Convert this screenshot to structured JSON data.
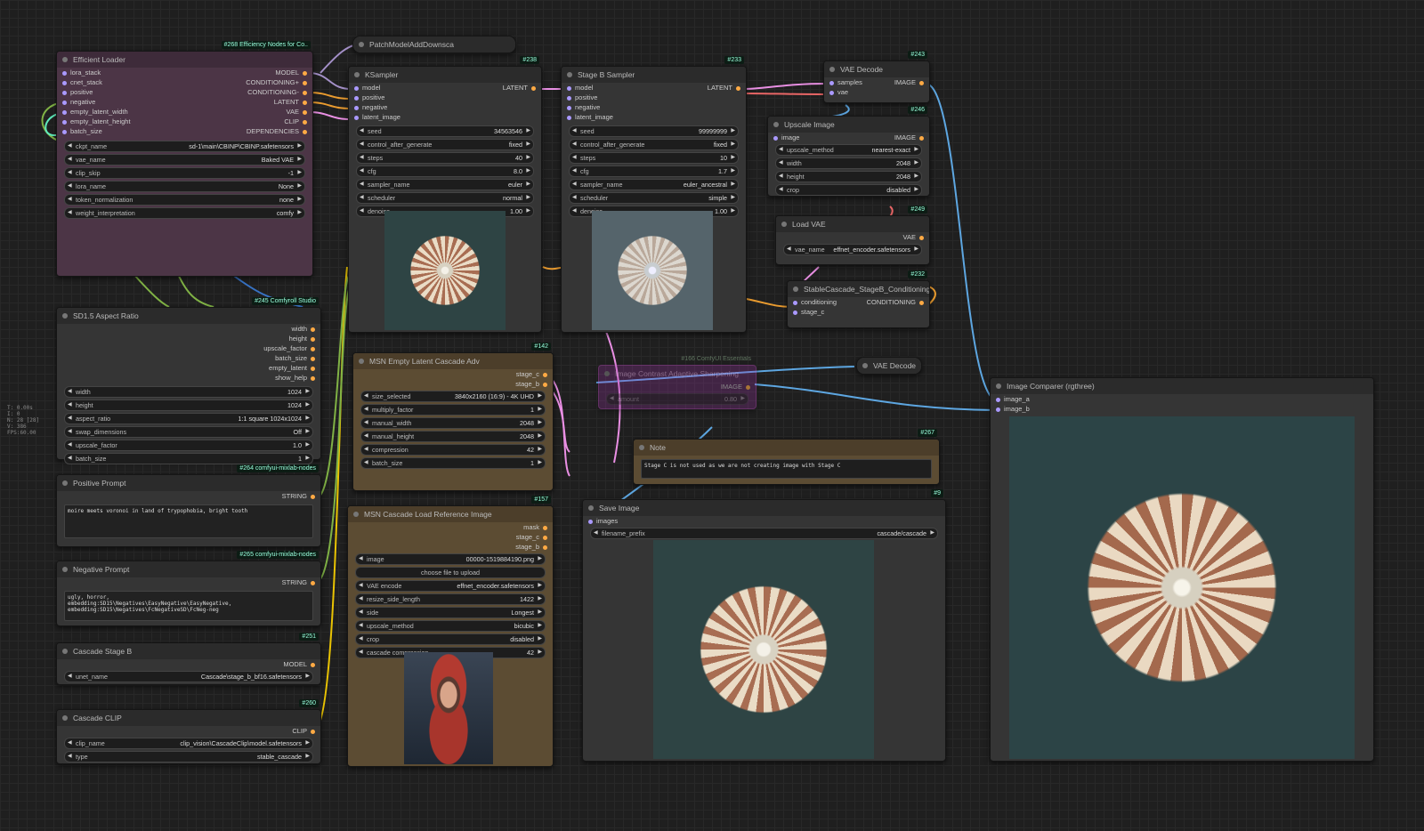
{
  "stats": [
    "T: 0.00s",
    "I: 0",
    "N: 28 [28]",
    "V: 386",
    "FPS:60.00"
  ],
  "nodes": {
    "efficient_loader": {
      "title": "Efficient Loader",
      "badge": "#268 Efficiency Nodes for Co..",
      "inputs": [
        "lora_stack",
        "cnet_stack",
        "positive",
        "negative",
        "empty_latent_width",
        "empty_latent_height",
        "batch_size"
      ],
      "outputs": [
        "MODEL",
        "CONDITIONING+",
        "CONDITIONING-",
        "LATENT",
        "VAE",
        "CLIP",
        "DEPENDENCIES"
      ],
      "widgets": [
        {
          "label": "ckpt_name",
          "value": "sd-1\\main\\CBINP\\CBINP.safetensors"
        },
        {
          "label": "vae_name",
          "value": "Baked VAE"
        },
        {
          "label": "clip_skip",
          "value": "-1"
        },
        {
          "label": "lora_name",
          "value": "None"
        },
        {
          "label": "token_normalization",
          "value": "none"
        },
        {
          "label": "weight_interpretation",
          "value": "comfy"
        }
      ]
    },
    "patch_model": {
      "title": "PatchModelAddDownsca"
    },
    "ksampler": {
      "title": "KSampler",
      "badge": "#238",
      "inputs": [
        "model",
        "positive",
        "negative",
        "latent_image"
      ],
      "outputs": [
        "LATENT"
      ],
      "widgets": [
        {
          "label": "seed",
          "value": "34563546"
        },
        {
          "label": "control_after_generate",
          "value": "fixed"
        },
        {
          "label": "steps",
          "value": "40"
        },
        {
          "label": "cfg",
          "value": "8.0"
        },
        {
          "label": "sampler_name",
          "value": "euler"
        },
        {
          "label": "scheduler",
          "value": "normal"
        },
        {
          "label": "denoise",
          "value": "1.00"
        }
      ]
    },
    "stageb_sampler": {
      "title": "Stage B Sampler",
      "badge": "#233",
      "inputs": [
        "model",
        "positive",
        "negative",
        "latent_image"
      ],
      "outputs": [
        "LATENT"
      ],
      "widgets": [
        {
          "label": "seed",
          "value": "99999999"
        },
        {
          "label": "control_after_generate",
          "value": "fixed"
        },
        {
          "label": "steps",
          "value": "10"
        },
        {
          "label": "cfg",
          "value": "1.7"
        },
        {
          "label": "sampler_name",
          "value": "euler_ancestral"
        },
        {
          "label": "scheduler",
          "value": "simple"
        },
        {
          "label": "denoise",
          "value": "1.00"
        }
      ]
    },
    "vae_decode": {
      "title": "VAE Decode",
      "badge": "#243",
      "inputs": [
        "samples",
        "vae"
      ],
      "outputs": [
        "IMAGE"
      ]
    },
    "upscale_image": {
      "title": "Upscale Image",
      "badge": "#246",
      "inputs": [
        "image"
      ],
      "outputs": [
        "IMAGE"
      ],
      "widgets": [
        {
          "label": "upscale_method",
          "value": "nearest-exact"
        },
        {
          "label": "width",
          "value": "2048"
        },
        {
          "label": "height",
          "value": "2048"
        },
        {
          "label": "crop",
          "value": "disabled"
        }
      ]
    },
    "load_vae": {
      "title": "Load VAE",
      "badge": "#249",
      "outputs": [
        "VAE"
      ],
      "widgets": [
        {
          "label": "vae_name",
          "value": "effnet_encoder.safetensors"
        }
      ]
    },
    "stablecascade_cond": {
      "title": "StableCascade_StageB_Conditioning",
      "badge": "#232",
      "inputs": [
        "conditioning",
        "stage_c"
      ],
      "outputs": [
        "CONDITIONING"
      ]
    },
    "vae_decode2": {
      "title": "VAE Decode"
    },
    "bypassed": {
      "title": "Image Contrast Adaptive Sharpening",
      "badge": "#166 ComfyUI Essentials",
      "outputs": [
        "IMAGE"
      ],
      "widgets": [
        {
          "label": "amount",
          "value": "0.80"
        }
      ]
    },
    "aspect_ratio": {
      "title": "SD1.5 Aspect Ratio",
      "badge": "#245 Comfyroll Studio",
      "outputs": [
        "width",
        "height",
        "upscale_factor",
        "batch_size",
        "empty_latent",
        "show_help"
      ],
      "widgets": [
        {
          "label": "width",
          "value": "1024"
        },
        {
          "label": "height",
          "value": "1024"
        },
        {
          "label": "aspect_ratio",
          "value": "1:1 square 1024x1024"
        },
        {
          "label": "swap_dimensions",
          "value": "Off"
        },
        {
          "label": "upscale_factor",
          "value": "1.0"
        },
        {
          "label": "batch_size",
          "value": "1"
        }
      ]
    },
    "positive_prompt": {
      "title": "Positive Prompt",
      "badge": "#264 comfyui-mixlab-nodes",
      "outputs": [
        "STRING"
      ],
      "text": "moire meets voronoi in land of trypophobia, bright tooth"
    },
    "negative_prompt": {
      "title": "Negative Prompt",
      "badge": "#265 comfyui-mixlab-nodes",
      "outputs": [
        "STRING"
      ],
      "text": "ugly, horror,\nembedding:SD15\\Negatives\\EasyNegative\\EasyNegative,\nembedding:SD15\\Negatives\\FcNegativeSD\\FcNeg-neg"
    },
    "cascade_stage_b": {
      "title": "Cascade Stage B",
      "badge": "#251",
      "outputs": [
        "MODEL"
      ],
      "widgets": [
        {
          "label": "unet_name",
          "value": "Cascade\\stage_b_bf16.safetensors"
        }
      ]
    },
    "cascade_clip": {
      "title": "Cascade CLIP",
      "badge": "#260",
      "outputs": [
        "CLIP"
      ],
      "widgets": [
        {
          "label": "clip_name",
          "value": "clip_vision\\CascadeClip\\model.safetensors"
        },
        {
          "label": "type",
          "value": "stable_cascade"
        }
      ]
    },
    "msn_empty": {
      "title": "MSN Empty Latent Cascade Adv",
      "badge": "#142",
      "outputs": [
        "stage_c",
        "stage_b"
      ],
      "widgets": [
        {
          "label": "size_selected",
          "value": "3840x2160 (16:9) - 4K UHD"
        },
        {
          "label": "multiply_factor",
          "value": "1"
        },
        {
          "label": "manual_width",
          "value": "2048"
        },
        {
          "label": "manual_height",
          "value": "2048"
        },
        {
          "label": "compression",
          "value": "42"
        },
        {
          "label": "batch_size",
          "value": "1"
        }
      ]
    },
    "msn_load_ref": {
      "title": "MSN Cascade Load Reference Image",
      "badge": "#157",
      "outputs": [
        "mask",
        "stage_c",
        "stage_b"
      ],
      "widgets": [
        {
          "label": "image",
          "value": "00000-1519884190.png"
        },
        {
          "button": "choose file to upload"
        },
        {
          "label": "VAE encode",
          "value": "effnet_encoder.safetensors"
        },
        {
          "label": "resize_side_length",
          "value": "1422"
        },
        {
          "label": "side",
          "value": "Longest"
        },
        {
          "label": "upscale_method",
          "value": "bicubic"
        },
        {
          "label": "crop",
          "value": "disabled"
        },
        {
          "label": "cascade compression",
          "value": "42"
        }
      ]
    },
    "note": {
      "title": "Note",
      "badge": "#267",
      "text": "Stage C is not used as we are not creating image with Stage C"
    },
    "save_image": {
      "title": "Save Image",
      "badge": "#9",
      "inputs": [
        "images"
      ],
      "widgets": [
        {
          "label": "filename_prefix",
          "value": "cascade/cascade"
        }
      ]
    },
    "image_comparer": {
      "title": "Image Comparer (rgthree)",
      "inputs": [
        "image_a",
        "image_b"
      ]
    }
  },
  "colors": {
    "model": "#b39ddb",
    "clip": "#ffd500",
    "conditioning": "#ffa931",
    "latent": "#ff9cf9",
    "vae": "#ff6e6e",
    "image": "#64b5f6",
    "string": "#8bc34a",
    "int": "#6fc",
    "purple_node": "#4c3546",
    "brown_node": "#5c4c33"
  }
}
